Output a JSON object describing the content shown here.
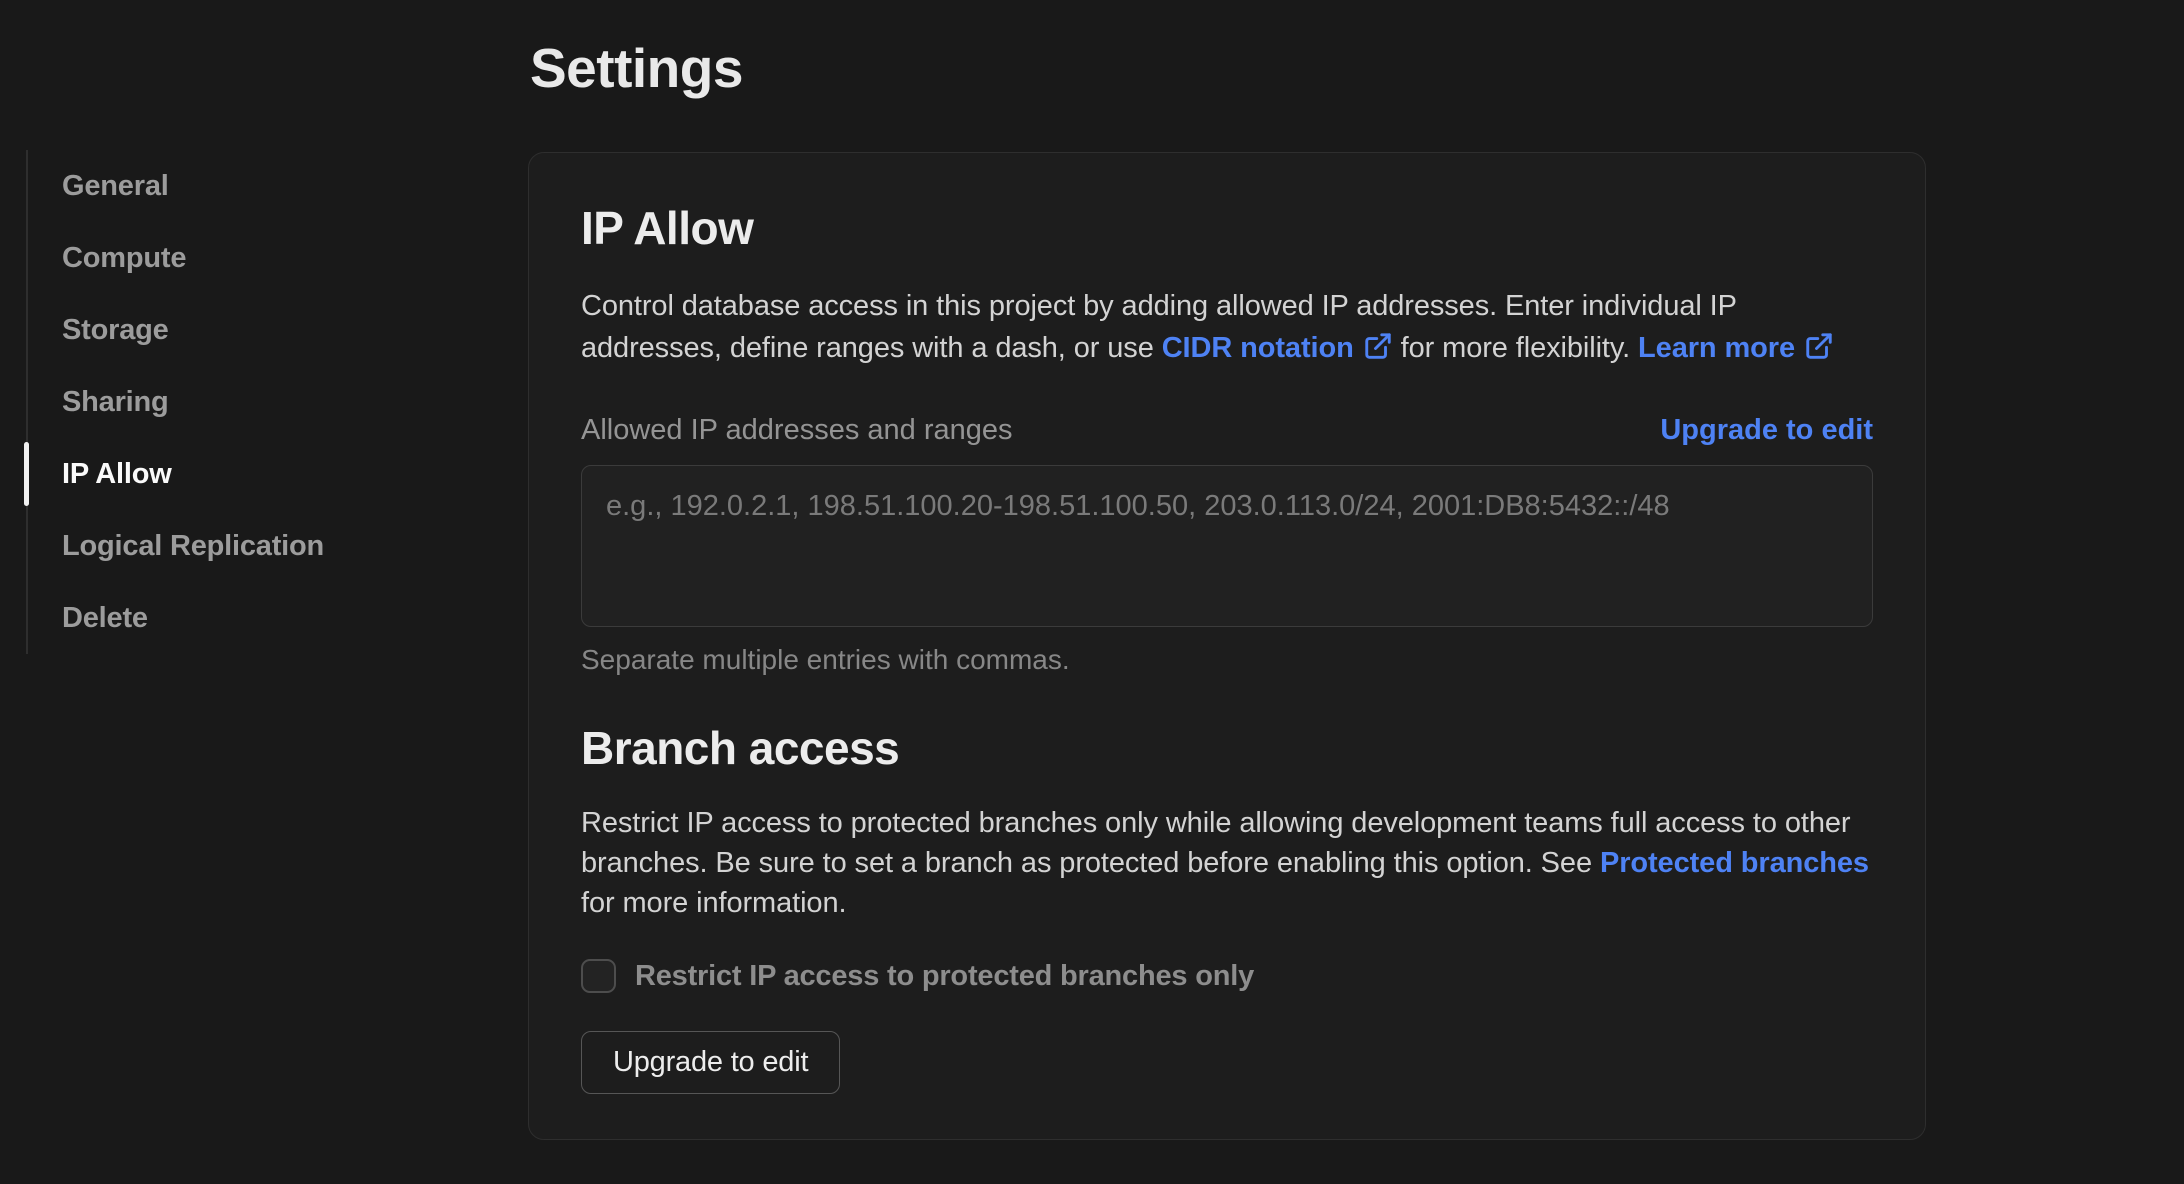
{
  "page": {
    "title": "Settings"
  },
  "sidebar": {
    "items": [
      {
        "label": "General",
        "active": false
      },
      {
        "label": "Compute",
        "active": false
      },
      {
        "label": "Storage",
        "active": false
      },
      {
        "label": "Sharing",
        "active": false
      },
      {
        "label": "IP Allow",
        "active": true
      },
      {
        "label": "Logical Replication",
        "active": false
      },
      {
        "label": "Delete",
        "active": false
      }
    ]
  },
  "ip_allow": {
    "heading": "IP Allow",
    "description_segments": [
      {
        "text": "Control database access in this project by adding allowed IP addresses. Enter individual IP addresses, define ranges with a dash, or use "
      },
      {
        "text": "CIDR notation",
        "link": true,
        "external_icon": true
      },
      {
        "text": " for more flexibility. "
      },
      {
        "text": "Learn more",
        "link": true,
        "external_icon": true
      }
    ],
    "field_label": "Allowed IP addresses and ranges",
    "upgrade_link_label": "Upgrade to edit",
    "textarea_value": "",
    "textarea_placeholder": "e.g., 192.0.2.1, 198.51.100.20-198.51.100.50, 203.0.113.0/24, 2001:DB8:5432::/48",
    "help_text": "Separate multiple entries with commas."
  },
  "branch_access": {
    "heading": "Branch access",
    "description_segments": [
      {
        "text": "Restrict IP access to protected branches only while allowing development teams full access to other branches. Be sure to set a branch as protected before enabling this option. See "
      },
      {
        "text": "Protected branches",
        "link": true
      },
      {
        "text": " for more information."
      }
    ],
    "checkbox_label": "Restrict IP access to protected branches only",
    "checkbox_checked": false,
    "button_label": "Upgrade to edit"
  },
  "colors": {
    "link_blue": "#4e82f4",
    "active_indicator": "#f2f2f2",
    "page_background": "#191919",
    "card_background": "#1d1d1d"
  }
}
